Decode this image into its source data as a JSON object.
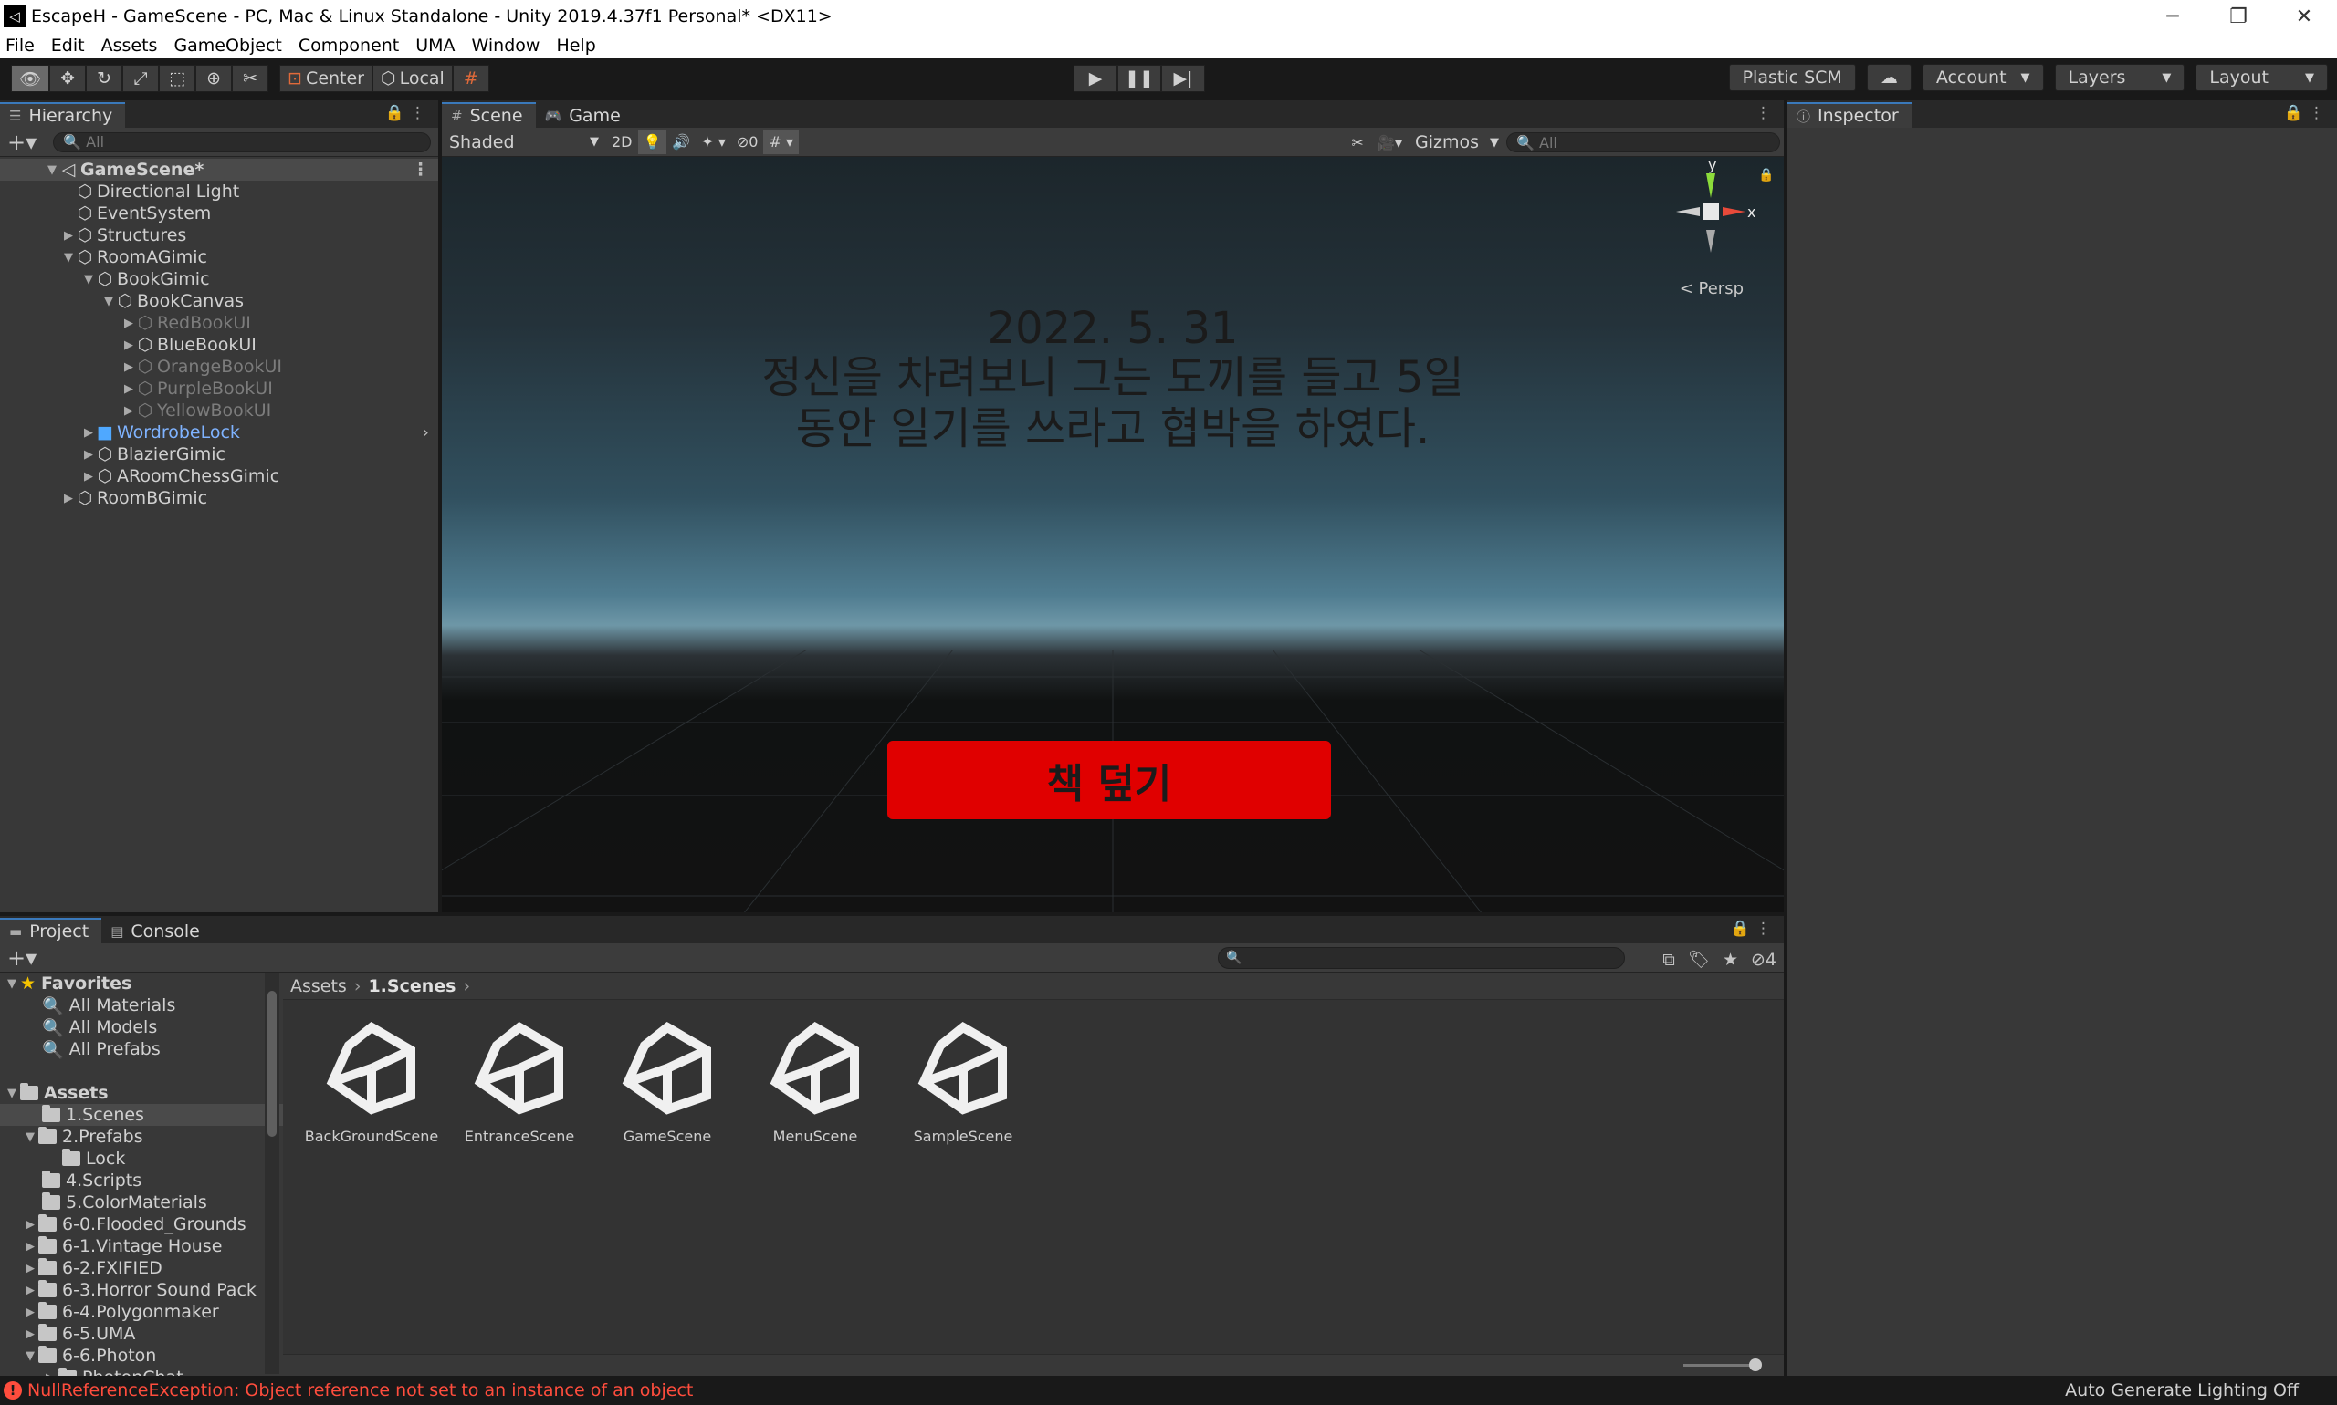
{
  "window": {
    "title": "EscapeH - GameScene - PC, Mac & Linux Standalone - Unity 2019.4.37f1 Personal* <DX11>",
    "minimize": "─",
    "restore": "❐",
    "close": "✕"
  },
  "menu": [
    "File",
    "Edit",
    "Assets",
    "GameObject",
    "Component",
    "UMA",
    "Window",
    "Help"
  ],
  "toolbar": {
    "pivot": "Center",
    "space": "Local",
    "plastic": "Plastic SCM",
    "account": "Account",
    "layers": "Layers",
    "layout": "Layout"
  },
  "hierarchy": {
    "tab": "Hierarchy",
    "search_placeholder": "All",
    "scene": "GameScene*",
    "items": [
      {
        "label": "Directional Light"
      },
      {
        "label": "EventSystem"
      },
      {
        "label": "Structures"
      },
      {
        "label": "RoomAGimic"
      },
      {
        "label": "BookGimic"
      },
      {
        "label": "BookCanvas"
      },
      {
        "label": "RedBookUI"
      },
      {
        "label": "BlueBookUI"
      },
      {
        "label": "OrangeBookUI"
      },
      {
        "label": "PurpleBookUI"
      },
      {
        "label": "YellowBookUI"
      },
      {
        "label": "WordrobeLock"
      },
      {
        "label": "BlazierGimic"
      },
      {
        "label": "ARoomChessGimic"
      },
      {
        "label": "RoomBGimic"
      }
    ]
  },
  "scene": {
    "tab_scene": "Scene",
    "tab_game": "Game",
    "shading": "Shaded",
    "mode_2d": "2D",
    "hidden_count": "0",
    "gizmos": "Gizmos",
    "search_placeholder": "All",
    "persp": "Persp",
    "axis_x": "x",
    "axis_y": "y",
    "ui_text_line1": "2022. 5. 31",
    "ui_text_line2": "정신을 차려보니 그는 도끼를 들고 5일",
    "ui_text_line3": "동안 일기를 쓰라고 협박을 하였다.",
    "ui_button": "책 덮기"
  },
  "inspector": {
    "tab": "Inspector"
  },
  "project": {
    "tab_project": "Project",
    "tab_console": "Console",
    "hidden_count": "4",
    "favorites_header": "Favorites",
    "favorites": [
      "All Materials",
      "All Models",
      "All Prefabs"
    ],
    "assets_header": "Assets",
    "folders": [
      {
        "label": "1.Scenes"
      },
      {
        "label": "2.Prefabs"
      },
      {
        "label": "Lock"
      },
      {
        "label": "4.Scripts"
      },
      {
        "label": "5.ColorMaterials"
      },
      {
        "label": "6-0.Flooded_Grounds"
      },
      {
        "label": "6-1.Vintage House"
      },
      {
        "label": "6-2.FXIFIED"
      },
      {
        "label": "6-3.Horror Sound Pack"
      },
      {
        "label": "6-4.Polygonmaker"
      },
      {
        "label": "6-5.UMA"
      },
      {
        "label": "6-6.Photon"
      },
      {
        "label": "PhotonChat"
      }
    ],
    "breadcrumb": [
      "Assets",
      "1.Scenes"
    ],
    "files": [
      "BackGroundScene",
      "EntranceScene",
      "GameScene",
      "MenuScene",
      "SampleScene"
    ]
  },
  "status": {
    "error": "NullReferenceException: Object reference not set to an instance of an object",
    "lighting": "Auto Generate Lighting Off"
  },
  "colors": {
    "accent": "#3a79bb",
    "error": "#ff4d3d",
    "button_red": "#e00000"
  }
}
